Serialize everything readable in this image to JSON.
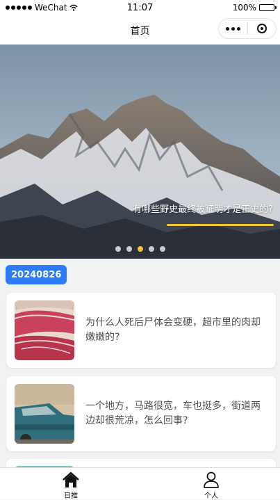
{
  "status_bar": {
    "carrier": "WeChat",
    "time": "11:07",
    "battery_percent": "100%"
  },
  "nav": {
    "title": "首页"
  },
  "banner": {
    "caption": "有哪些野史最终被证明才是正史的?",
    "dot_count": 5,
    "active_dot": 3,
    "accent_color": "#f3c533"
  },
  "date_badge": "20240826",
  "articles": [
    {
      "title": "为什么人死后尸体会变硬，超市里的肉却嫩嫩的?",
      "thumb": "raw-meat"
    },
    {
      "title": "一个地方，马路很宽，车也挺多，街道两边却很荒凉，怎么回事?",
      "thumb": "old-truck"
    },
    {
      "title": "",
      "thumb": "partial"
    }
  ],
  "tabs": [
    {
      "label": "日推",
      "icon": "home-icon"
    },
    {
      "label": "个人",
      "icon": "user-icon"
    }
  ]
}
